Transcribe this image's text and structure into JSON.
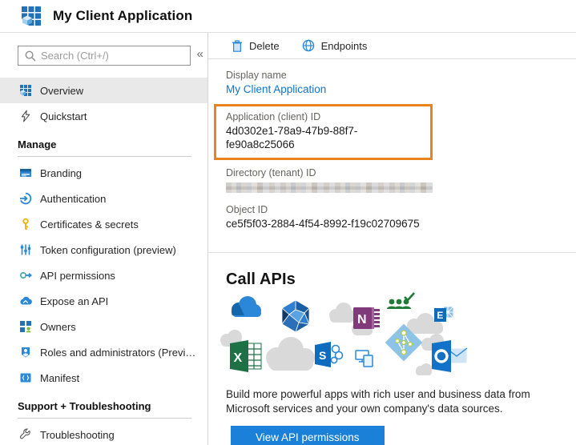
{
  "header": {
    "title": "My Client Application"
  },
  "sidebar": {
    "search_placeholder": "Search (Ctrl+/)",
    "collapse_glyph": "«",
    "nav": [
      {
        "type": "item",
        "label": "Overview",
        "selected": true
      },
      {
        "type": "item",
        "label": "Quickstart"
      },
      {
        "type": "section",
        "label": "Manage"
      },
      {
        "type": "item",
        "label": "Branding"
      },
      {
        "type": "item",
        "label": "Authentication"
      },
      {
        "type": "item",
        "label": "Certificates & secrets"
      },
      {
        "type": "item",
        "label": "Token configuration (preview)"
      },
      {
        "type": "item",
        "label": "API permissions"
      },
      {
        "type": "item",
        "label": "Expose an API"
      },
      {
        "type": "item",
        "label": "Owners"
      },
      {
        "type": "item",
        "label": "Roles and administrators (Preview)"
      },
      {
        "type": "item",
        "label": "Manifest"
      },
      {
        "type": "section",
        "label": "Support + Troubleshooting"
      },
      {
        "type": "item",
        "label": "Troubleshooting"
      }
    ]
  },
  "main": {
    "toolbar": {
      "delete_label": "Delete",
      "endpoints_label": "Endpoints"
    },
    "fields": [
      {
        "label": "Display name",
        "value": "My Client Application",
        "link": true
      },
      {
        "label": "Application (client) ID",
        "value": "4d0302e1-78a9-47b9-88f7-fe90a8c25066",
        "highlighted": true
      },
      {
        "label": "Directory (tenant) ID",
        "value": "",
        "redacted": true
      },
      {
        "label": "Object ID",
        "value": "ce5f5f03-2884-4f54-8992-f19c02709675"
      }
    ],
    "call_apis": {
      "title": "Call APIs",
      "description": "Build more powerful apps with rich user and business data from Microsoft services and your own company's data sources.",
      "button_label": "View API permissions",
      "service_icons": [
        "onedrive",
        "microsoft-graph",
        "onenote",
        "planner-people",
        "exchange",
        "excel",
        "sharepoint",
        "devices",
        "azure-ad",
        "outlook",
        "clouds"
      ]
    }
  },
  "colors": {
    "accent": "#0078d4",
    "highlight_border": "#e8831d",
    "button": "#1a80d8",
    "selected_row": "#e9e9e9"
  }
}
